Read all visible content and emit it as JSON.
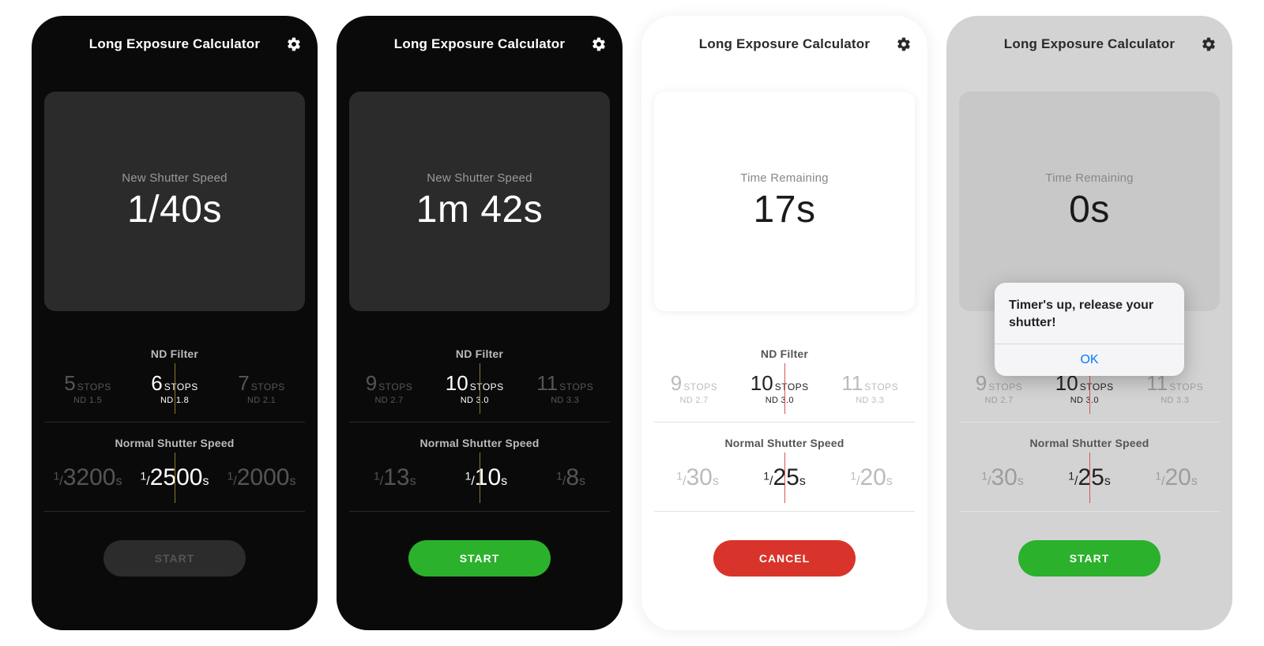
{
  "appTitle": "Long Exposure Calculator",
  "labels": {
    "newShutterSpeed": "New Shutter Speed",
    "timeRemaining": "Time Remaining",
    "ndFilter": "ND Filter",
    "normalShutterSpeed": "Normal Shutter Speed",
    "stops": "STOPS"
  },
  "screens": [
    {
      "theme": "dark",
      "cardLabel": "New Shutter Speed",
      "cardValue": "1/40s",
      "ndFilter": {
        "left": {
          "stops": "5",
          "nd": "ND 1.5"
        },
        "center": {
          "stops": "6",
          "nd": "ND 1.8"
        },
        "right": {
          "stops": "7",
          "nd": "ND 2.1"
        }
      },
      "shutter": {
        "left": {
          "numerator": "1",
          "denominator": "3200",
          "suffix": "s"
        },
        "center": {
          "numerator": "1",
          "denominator": "2500",
          "suffix": "s"
        },
        "right": {
          "numerator": "1",
          "denominator": "2000",
          "suffix": "s"
        }
      },
      "button": {
        "label": "START",
        "style": "disabled"
      }
    },
    {
      "theme": "dark",
      "cardLabel": "New Shutter Speed",
      "cardValue": "1m 42s",
      "ndFilter": {
        "left": {
          "stops": "9",
          "nd": "ND 2.7"
        },
        "center": {
          "stops": "10",
          "nd": "ND 3.0"
        },
        "right": {
          "stops": "11",
          "nd": "ND 3.3"
        }
      },
      "shutter": {
        "left": {
          "numerator": "1",
          "denominator": "13",
          "suffix": "s"
        },
        "center": {
          "numerator": "1",
          "denominator": "10",
          "suffix": "s"
        },
        "right": {
          "numerator": "1",
          "denominator": "8",
          "suffix": "s"
        }
      },
      "button": {
        "label": "START",
        "style": "green"
      }
    },
    {
      "theme": "light",
      "cardLabel": "Time Remaining",
      "cardValue": "17s",
      "ndFilter": {
        "left": {
          "stops": "9",
          "nd": "ND 2.7"
        },
        "center": {
          "stops": "10",
          "nd": "ND 3.0"
        },
        "right": {
          "stops": "11",
          "nd": "ND 3.3"
        }
      },
      "shutter": {
        "left": {
          "numerator": "1",
          "denominator": "30",
          "suffix": "s"
        },
        "center": {
          "numerator": "1",
          "denominator": "25",
          "suffix": "s"
        },
        "right": {
          "numerator": "1",
          "denominator": "20",
          "suffix": "s"
        }
      },
      "button": {
        "label": "CANCEL",
        "style": "red"
      }
    },
    {
      "theme": "light-dim",
      "cardLabel": "Time Remaining",
      "cardValue": "0s",
      "ndFilter": {
        "left": {
          "stops": "9",
          "nd": "ND 2.7"
        },
        "center": {
          "stops": "10",
          "nd": "ND 3.0"
        },
        "right": {
          "stops": "11",
          "nd": "ND 3.3"
        }
      },
      "shutter": {
        "left": {
          "numerator": "1",
          "denominator": "30",
          "suffix": "s"
        },
        "center": {
          "numerator": "1",
          "denominator": "25",
          "suffix": "s"
        },
        "right": {
          "numerator": "1",
          "denominator": "20",
          "suffix": "s"
        }
      },
      "button": {
        "label": "START",
        "style": "green"
      },
      "alert": {
        "message": "Timer's up, release your shutter!",
        "ok": "OK"
      }
    }
  ]
}
